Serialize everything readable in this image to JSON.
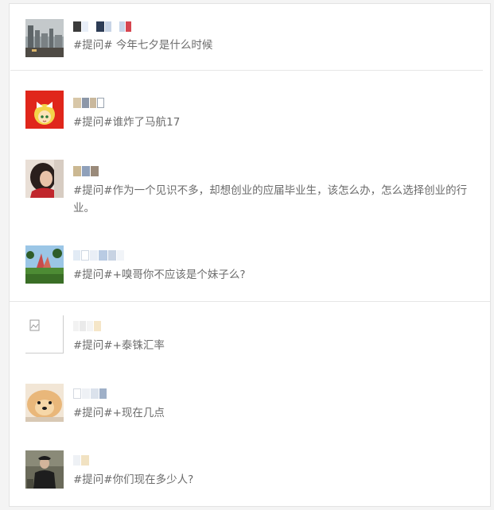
{
  "questions": [
    {
      "text": "#提问# 今年七夕是什么时候"
    },
    {
      "text": "#提问#谁炸了马航17"
    },
    {
      "text": "#提问#作为一个见识不多，却想创业的应届毕业生，该怎么办，怎么选择创业的行业。"
    },
    {
      "text": "#提问#+嗅哥你不应该是个妹子么?"
    },
    {
      "text": "#提问#+泰铢汇率"
    },
    {
      "text": "#提问#+现在几点"
    },
    {
      "text": "#提问#你们现在多少人?"
    }
  ],
  "avatars": [
    {
      "icon": "city-fog-photo-icon"
    },
    {
      "icon": "anime-girl-avatar-icon"
    },
    {
      "icon": "girl-portrait-avatar-icon"
    },
    {
      "icon": "landscape-photo-avatar-icon"
    },
    {
      "icon": "broken-image-icon"
    },
    {
      "icon": "dog-avatar-icon"
    },
    {
      "icon": "man-portrait-avatar-icon"
    }
  ]
}
